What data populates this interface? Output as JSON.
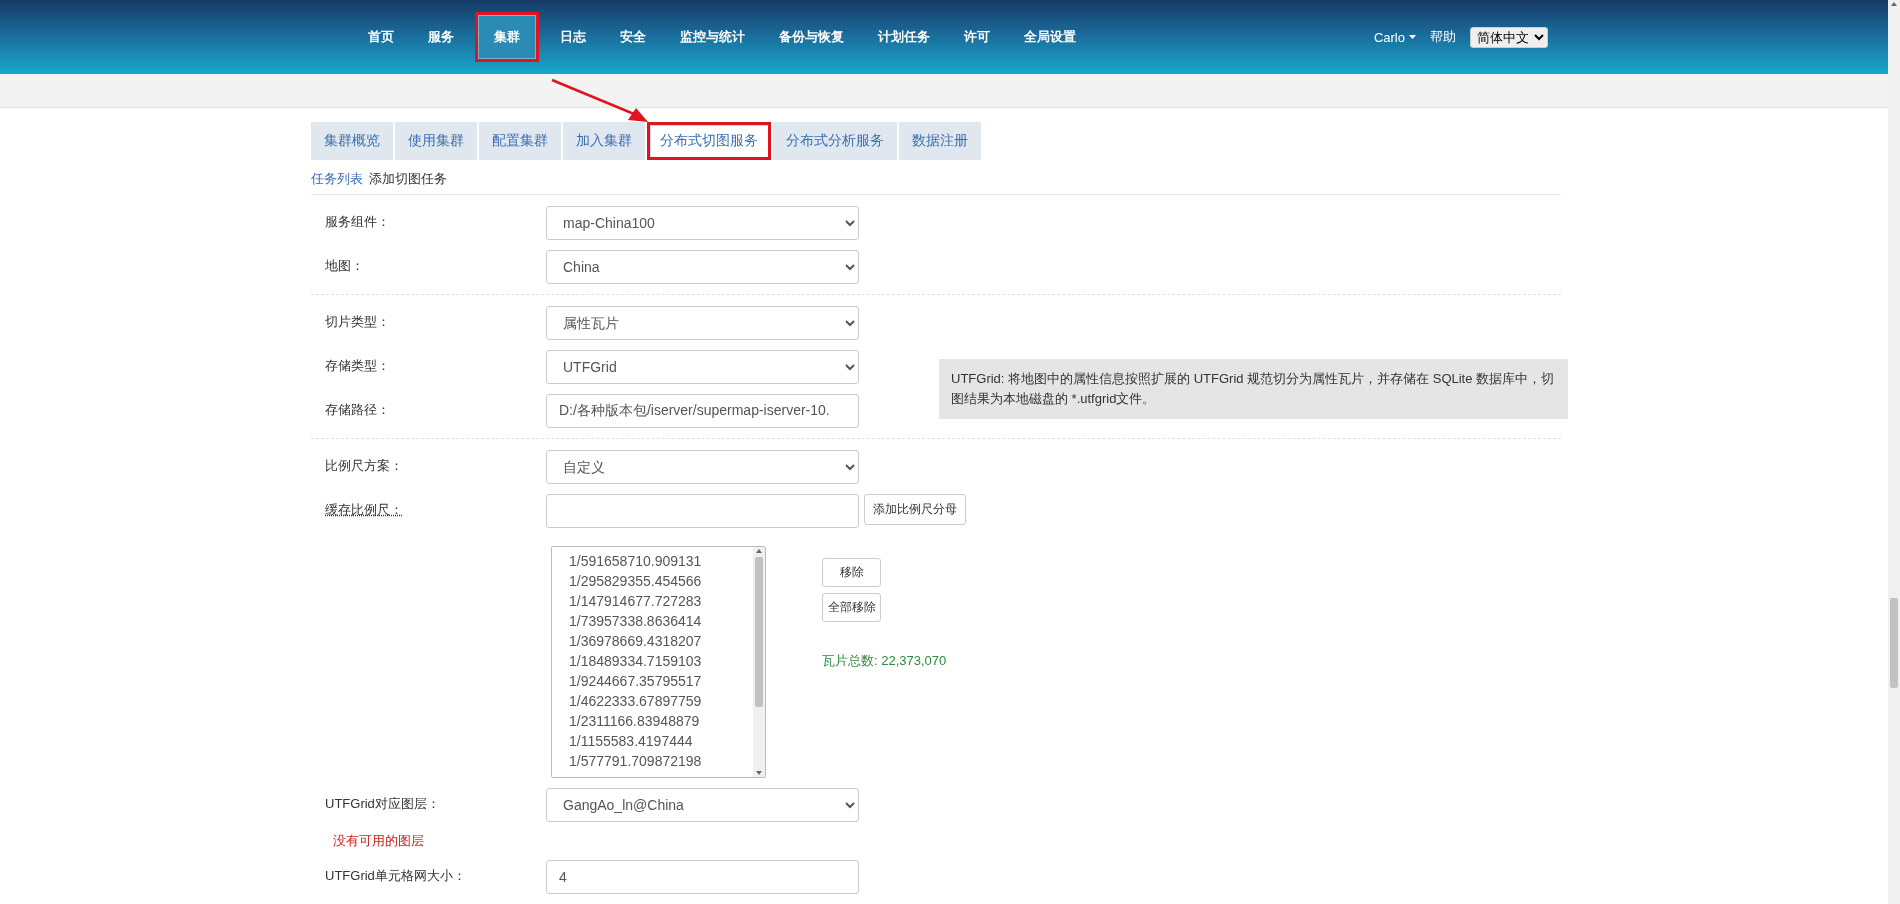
{
  "header": {
    "nav": [
      {
        "label": "首页",
        "selected": false,
        "annotated": false
      },
      {
        "label": "服务",
        "selected": false,
        "annotated": false
      },
      {
        "label": "集群",
        "selected": true,
        "annotated": true
      },
      {
        "label": "日志",
        "selected": false,
        "annotated": false
      },
      {
        "label": "安全",
        "selected": false,
        "annotated": false
      },
      {
        "label": "监控与统计",
        "selected": false,
        "annotated": false
      },
      {
        "label": "备份与恢复",
        "selected": false,
        "annotated": false
      },
      {
        "label": "计划任务",
        "selected": false,
        "annotated": false
      },
      {
        "label": "许可",
        "selected": false,
        "annotated": false
      },
      {
        "label": "全局设置",
        "selected": false,
        "annotated": false
      }
    ],
    "user": "Carlo",
    "help": "帮助",
    "language": "简体中文"
  },
  "annotation_arrow": true,
  "tabs": [
    {
      "label": "集群概览",
      "selected": false,
      "annotated": false
    },
    {
      "label": "使用集群",
      "selected": false,
      "annotated": false
    },
    {
      "label": "配置集群",
      "selected": false,
      "annotated": false
    },
    {
      "label": "加入集群",
      "selected": false,
      "annotated": false
    },
    {
      "label": "分布式切图服务",
      "selected": true,
      "annotated": true
    },
    {
      "label": "分布式分析服务",
      "selected": false,
      "annotated": false
    },
    {
      "label": "数据注册",
      "selected": false,
      "annotated": false
    }
  ],
  "breadcrumb": [
    {
      "label": "任务列表",
      "kind": "link"
    },
    {
      "label": "添加切图任务",
      "kind": "current"
    }
  ],
  "form": {
    "groups": [
      [
        {
          "kind": "select",
          "label": "服务组件：",
          "value": "map-China100"
        },
        {
          "kind": "select",
          "label": "地图：",
          "value": "China"
        }
      ],
      [
        {
          "kind": "select",
          "label": "切片类型：",
          "value": "属性瓦片"
        },
        {
          "kind": "select",
          "label": "存储类型：",
          "value": "UTFGrid",
          "note": "UTFGrid: 将地图中的属性信息按照扩展的 UTFGrid 规范切分为属性瓦片，并存储在 SQLite 数据库中，切图结果为本地磁盘的 *.utfgrid文件。"
        },
        {
          "kind": "text",
          "label": "存储路径：",
          "value": "D:/各种版本包/iserver/supermap-iserver-10."
        }
      ],
      [
        {
          "kind": "select",
          "label": "比例尺方案：",
          "value": "自定义"
        },
        {
          "kind": "input_button",
          "label": "缓存比例尺：",
          "button": "添加比例尺分母"
        },
        {
          "kind": "listbox",
          "items": [
            "1/591658710.909131",
            "1/295829355.454566",
            "1/147914677.727283",
            "1/73957338.8636414",
            "1/36978669.4318207",
            "1/18489334.7159103",
            "1/9244667.35795517",
            "1/4622333.67897759",
            "1/2311166.83948879",
            "1/1155583.4197444",
            "1/577791.709872198"
          ],
          "buttons": [
            "移除",
            "全部移除"
          ],
          "total": "瓦片总数: 22,373,070"
        },
        {
          "kind": "select",
          "label": "UTFGrid对应图层：",
          "value": "GangAo_ln@China"
        },
        {
          "kind": "error",
          "text": "没有可用的图层"
        },
        {
          "kind": "text",
          "label": "UTFGrid单元格网大小：",
          "value": "4"
        }
      ]
    ]
  }
}
